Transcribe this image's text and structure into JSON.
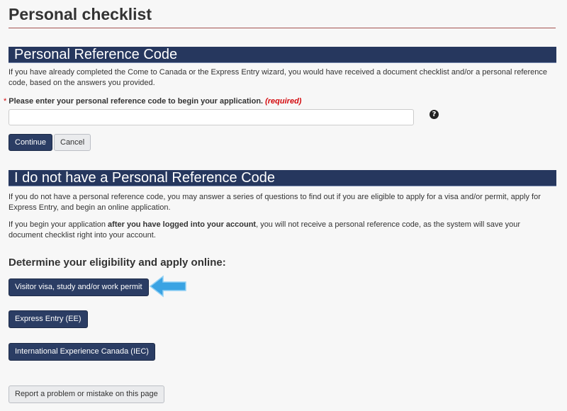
{
  "page": {
    "title": "Personal checklist"
  },
  "reference_section": {
    "heading": "Personal Reference Code",
    "intro": "If you have already completed the Come to Canada or the Express Entry wizard, you would have received a document checklist and/or a personal reference code, based on the answers you provided.",
    "field_label": "Please enter your personal reference code to begin your application.",
    "required_marker": "*",
    "required_text": "(required)",
    "input_value": "",
    "input_placeholder": "",
    "help_icon": "question-circle-icon",
    "continue_label": "Continue",
    "cancel_label": "Cancel"
  },
  "no_code_section": {
    "heading": "I do not have a Personal Reference Code",
    "para1": "If you do not have a personal reference code, you may answer a series of questions to find out if you are eligible to apply for a visa and/or permit, apply for Express Entry, and begin an online application.",
    "para2_before": "If you begin your application ",
    "para2_bold": "after you have logged into your account",
    "para2_after": ", you will not receive a personal reference code, as the system will save your document checklist right into your account.",
    "eligibility_heading": "Determine your eligibility and apply online:",
    "buttons": [
      {
        "label": "Visitor visa, study and/or work permit"
      },
      {
        "label": "Express Entry (EE)"
      },
      {
        "label": "International Experience Canada (IEC)"
      }
    ],
    "pointer_icon": "left-arrow-icon"
  },
  "footer": {
    "report_label": "Report a problem or mistake on this page"
  },
  "colors": {
    "section_bar": "#26375e",
    "primary_button": "#2b3d64",
    "required": "#d3080c",
    "arrow": "#3aa3e3",
    "title_rule": "#a45451"
  }
}
